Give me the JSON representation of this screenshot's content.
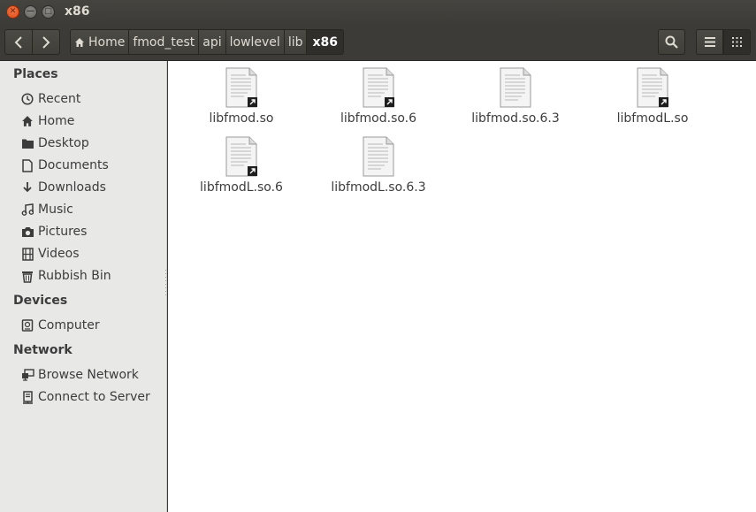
{
  "window": {
    "title": "x86"
  },
  "toolbar": {
    "breadcrumbs": [
      "Home",
      "fmod_test",
      "api",
      "lowlevel",
      "lib",
      "x86"
    ]
  },
  "sidebar": {
    "places_header": "Places",
    "places": [
      {
        "label": "Recent",
        "icon": "clock-icon"
      },
      {
        "label": "Home",
        "icon": "home-icon"
      },
      {
        "label": "Desktop",
        "icon": "folder-icon"
      },
      {
        "label": "Documents",
        "icon": "document-icon"
      },
      {
        "label": "Downloads",
        "icon": "download-icon"
      },
      {
        "label": "Music",
        "icon": "music-icon"
      },
      {
        "label": "Pictures",
        "icon": "camera-icon"
      },
      {
        "label": "Videos",
        "icon": "film-icon"
      },
      {
        "label": "Rubbish Bin",
        "icon": "trash-icon"
      }
    ],
    "devices_header": "Devices",
    "devices": [
      {
        "label": "Computer",
        "icon": "drive-icon"
      }
    ],
    "network_header": "Network",
    "network": [
      {
        "label": "Browse Network",
        "icon": "network-icon"
      },
      {
        "label": "Connect to Server",
        "icon": "server-icon"
      }
    ]
  },
  "files": [
    {
      "name": "libfmod.so",
      "symlink": true
    },
    {
      "name": "libfmod.so.6",
      "symlink": true
    },
    {
      "name": "libfmod.so.6.3",
      "symlink": false
    },
    {
      "name": "libfmodL.so",
      "symlink": true
    },
    {
      "name": "libfmodL.so.6",
      "symlink": true
    },
    {
      "name": "libfmodL.so.6.3",
      "symlink": false
    }
  ]
}
